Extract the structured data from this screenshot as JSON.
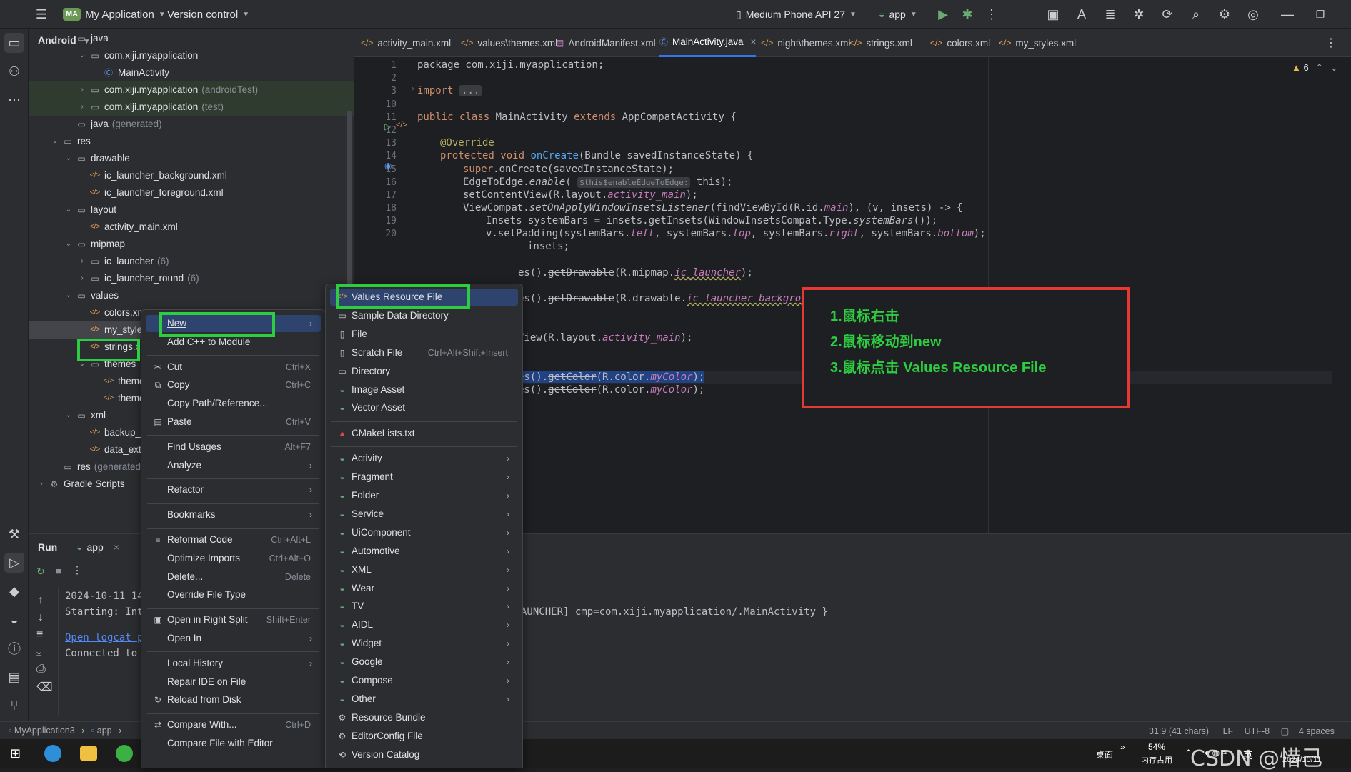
{
  "titlebar": {
    "project_badge": "MA",
    "project_name": "My Application",
    "version_control": "Version control",
    "device": "Medium Phone API 27",
    "run_config": "app"
  },
  "project_panel": {
    "view_selector": "Android",
    "tree": [
      {
        "label": "java",
        "extra": "",
        "indent": 2,
        "arrow": "down",
        "icon": "folder"
      },
      {
        "label": "com.xiji.myapplication",
        "extra": "",
        "indent": 3,
        "arrow": "down",
        "icon": "folder"
      },
      {
        "label": "MainActivity",
        "extra": "",
        "indent": 4,
        "arrow": "",
        "icon": "class"
      },
      {
        "label": "com.xiji.myapplication",
        "extra": "(androidTest)",
        "indent": 3,
        "arrow": "right",
        "icon": "folder"
      },
      {
        "label": "com.xiji.myapplication",
        "extra": "(test)",
        "indent": 3,
        "arrow": "right",
        "icon": "folder"
      },
      {
        "label": "java",
        "extra": "(generated)",
        "indent": 2,
        "arrow": "",
        "icon": "folder"
      },
      {
        "label": "res",
        "extra": "",
        "indent": 1,
        "arrow": "down",
        "icon": "folder"
      },
      {
        "label": "drawable",
        "extra": "",
        "indent": 2,
        "arrow": "down",
        "icon": "folder"
      },
      {
        "label": "ic_launcher_background.xml",
        "extra": "",
        "indent": 3,
        "arrow": "",
        "icon": "xml"
      },
      {
        "label": "ic_launcher_foreground.xml",
        "extra": "",
        "indent": 3,
        "arrow": "",
        "icon": "xml"
      },
      {
        "label": "layout",
        "extra": "",
        "indent": 2,
        "arrow": "down",
        "icon": "folder"
      },
      {
        "label": "activity_main.xml",
        "extra": "",
        "indent": 3,
        "arrow": "",
        "icon": "xml"
      },
      {
        "label": "mipmap",
        "extra": "",
        "indent": 2,
        "arrow": "down",
        "icon": "folder"
      },
      {
        "label": "ic_launcher",
        "extra": "(6)",
        "indent": 3,
        "arrow": "right",
        "icon": "folder"
      },
      {
        "label": "ic_launcher_round",
        "extra": "(6)",
        "indent": 3,
        "arrow": "right",
        "icon": "folder"
      },
      {
        "label": "values",
        "extra": "",
        "indent": 2,
        "arrow": "down",
        "icon": "folder"
      },
      {
        "label": "colors.xml",
        "extra": "",
        "indent": 3,
        "arrow": "",
        "icon": "xml"
      },
      {
        "label": "my_styles.xml",
        "extra": "",
        "indent": 3,
        "arrow": "",
        "icon": "xml"
      },
      {
        "label": "strings.xml",
        "extra": "",
        "indent": 3,
        "arrow": "",
        "icon": "xml"
      },
      {
        "label": "themes",
        "extra": "",
        "indent": 3,
        "arrow": "down",
        "icon": "folder"
      },
      {
        "label": "themes.xml",
        "extra": "",
        "indent": 4,
        "arrow": "",
        "icon": "xml"
      },
      {
        "label": "themes.xml",
        "extra": "(night)",
        "indent": 4,
        "arrow": "",
        "icon": "xml"
      },
      {
        "label": "xml",
        "extra": "",
        "indent": 2,
        "arrow": "down",
        "icon": "folder"
      },
      {
        "label": "backup_rules.xml",
        "extra": "",
        "indent": 3,
        "arrow": "",
        "icon": "xml"
      },
      {
        "label": "data_extraction_rules.xml",
        "extra": "",
        "indent": 3,
        "arrow": "",
        "icon": "xml"
      },
      {
        "label": "res",
        "extra": "(generated)",
        "indent": 1,
        "arrow": "",
        "icon": "folder"
      },
      {
        "label": "Gradle Scripts",
        "extra": "",
        "indent": 0,
        "arrow": "right",
        "icon": "gradle"
      }
    ]
  },
  "tabs": [
    {
      "label": "activity_main.xml",
      "icon": "xml"
    },
    {
      "label": "values\\themes.xml",
      "icon": "xml"
    },
    {
      "label": "AndroidManifest.xml",
      "icon": "manifest"
    },
    {
      "label": "MainActivity.java",
      "icon": "class",
      "active": true
    },
    {
      "label": "night\\themes.xml",
      "icon": "xml"
    },
    {
      "label": "strings.xml",
      "icon": "xml"
    },
    {
      "label": "colors.xml",
      "icon": "xml"
    },
    {
      "label": "my_styles.xml",
      "icon": "xml"
    }
  ],
  "editor": {
    "warnings": "6",
    "line_numbers": [
      "1",
      "2",
      "3",
      "10",
      "11",
      "12",
      "13",
      "14",
      "15",
      "16",
      "17",
      "18",
      "19",
      "20"
    ],
    "inlay_hint": "$this$enableEdgeToEdge:",
    "fragments": {
      "l1": "package com.xiji.myapplication;",
      "l3_kw": "import",
      "l3_fold": "...",
      "l11_a": "public class",
      "l11_b": " MainActivity ",
      "l11_c": "extends",
      "l11_d": " AppCompatActivity {",
      "l13": "@Override",
      "l14_a": "protected void ",
      "l14_b": "onCreate",
      "l14_c": "(Bundle savedInstanceState) {",
      "l15_a": "super",
      "l15_b": ".onCreate(savedInstanceState);",
      "l16_a": "EdgeToEdge.",
      "l16_b": "enable",
      "l16_c": "( ",
      "l16_d": " this);",
      "l17_a": "setContentView(R.layout.",
      "l17_b": "activity_main",
      "l17_c": ");",
      "l18_a": "ViewCompat.",
      "l18_b": "setOnApplyWindowInsetsListener",
      "l18_c": "(findViewById(R.id.",
      "l18_d": "main",
      "l18_e": "), (v, insets) -> {",
      "l19_a": "Insets systemBars = insets.getInsets(WindowInsetsCompat.Type.",
      "l19_b": "systemBars",
      "l19_c": "());",
      "l20_a": "v.setPadding(systemBars.",
      "l20_b": "left",
      "l20_c": ", systemBars.",
      "l20_d": "top",
      "l20_e": ", systemBars.",
      "l20_f": "right",
      "l20_g": ", systemBars.",
      "l20_h": "bottom",
      "l20_i": ");",
      "l21": "insets;",
      "l22_a": "es().",
      "l22_b": "getDrawable",
      "l22_c": "(R.mipmap.",
      "l22_d": "ic_launcher",
      "l22_e": ");",
      "l23_a": "es().",
      "l23_b": "getDrawable",
      "l23_c": "(R.drawable.",
      "l23_d": "ic_launcher_background",
      "l23_e": ");",
      "l24_a": "View(R.layout.",
      "l24_b": "activity_main",
      "l24_c": ");",
      "l25_a": "es().",
      "l25_b": "getColor",
      "l25_c": "(R.color.",
      "l25_d": "myColor",
      "l25_e": ");",
      "l26_a": "es().",
      "l26_b": "getColor",
      "l26_c": "(R.color.",
      "l26_d": "myColor",
      "l26_e": ");"
    }
  },
  "annotation": {
    "lines": [
      "1.鼠标右击",
      "2.鼠标移动到new",
      "3.鼠标点击 Values Resource File"
    ]
  },
  "run_panel": {
    "title": "Run",
    "tab": "app",
    "console": [
      "2024-10-11 14",
      "Starting: Int",
      "",
      "Open logcat pa",
      "Connected to p"
    ],
    "console_tail": "AUNCHER] cmp=com.xiji.myapplication/.MainActivity }"
  },
  "context_menu": [
    {
      "label": "New",
      "submenu": true,
      "selected": true
    },
    {
      "label": "Add C++ to Module"
    },
    {
      "sep": true
    },
    {
      "label": "Cut",
      "icon": "cut-icon",
      "glyph": "✂",
      "shortcut": "Ctrl+X"
    },
    {
      "label": "Copy",
      "icon": "copy-icon",
      "glyph": "⧉",
      "shortcut": "Ctrl+C"
    },
    {
      "label": "Copy Path/Reference..."
    },
    {
      "label": "Paste",
      "icon": "paste-icon",
      "glyph": "▤",
      "shortcut": "Ctrl+V"
    },
    {
      "sep": true
    },
    {
      "label": "Find Usages",
      "shortcut": "Alt+F7"
    },
    {
      "label": "Analyze",
      "submenu": true
    },
    {
      "sep": true
    },
    {
      "label": "Refactor",
      "submenu": true
    },
    {
      "sep": true
    },
    {
      "label": "Bookmarks",
      "submenu": true
    },
    {
      "sep": true
    },
    {
      "label": "Reformat Code",
      "icon": "reformat-icon",
      "glyph": "≡",
      "shortcut": "Ctrl+Alt+L"
    },
    {
      "label": "Optimize Imports",
      "shortcut": "Ctrl+Alt+O"
    },
    {
      "label": "Delete...",
      "shortcut": "Delete"
    },
    {
      "label": "Override File Type"
    },
    {
      "sep": true
    },
    {
      "label": "Open in Right Split",
      "icon": "split-icon",
      "glyph": "▣",
      "shortcut": "Shift+Enter"
    },
    {
      "label": "Open In",
      "submenu": true
    },
    {
      "sep": true
    },
    {
      "label": "Local History",
      "submenu": true
    },
    {
      "label": "Repair IDE on File"
    },
    {
      "label": "Reload from Disk",
      "icon": "reload-icon",
      "glyph": "↻"
    },
    {
      "sep": true
    },
    {
      "label": "Compare With...",
      "icon": "compare-icon",
      "glyph": "⇄",
      "shortcut": "Ctrl+D"
    },
    {
      "label": "Compare File with Editor"
    }
  ],
  "new_submenu": [
    {
      "label": "Values Resource File",
      "icon": "xml-file-icon",
      "glyph": "</>",
      "selected": true
    },
    {
      "label": "Sample Data Directory",
      "icon": "folder-icon",
      "glyph": "▭"
    },
    {
      "label": "File",
      "icon": "file-icon",
      "glyph": "▯"
    },
    {
      "label": "Scratch File",
      "icon": "scratch-icon",
      "glyph": "▯",
      "shortcut": "Ctrl+Alt+Shift+Insert"
    },
    {
      "label": "Directory",
      "icon": "folder-icon",
      "glyph": "▭"
    },
    {
      "label": "Image Asset",
      "icon": "android-icon",
      "glyph": "◒"
    },
    {
      "label": "Vector Asset",
      "icon": "android-icon",
      "glyph": "◒"
    },
    {
      "sep": true
    },
    {
      "label": "CMakeLists.txt",
      "icon": "cmake-icon",
      "glyph": "▲"
    },
    {
      "sep": true
    },
    {
      "label": "Activity",
      "icon": "android-icon",
      "glyph": "◒",
      "submenu": true
    },
    {
      "label": "Fragment",
      "icon": "android-icon",
      "glyph": "◒",
      "submenu": true
    },
    {
      "label": "Folder",
      "icon": "android-icon",
      "glyph": "◒",
      "submenu": true
    },
    {
      "label": "Service",
      "icon": "android-icon",
      "glyph": "◒",
      "submenu": true
    },
    {
      "label": "UiComponent",
      "icon": "android-icon",
      "glyph": "◒",
      "submenu": true
    },
    {
      "label": "Automotive",
      "icon": "android-icon",
      "glyph": "◒",
      "submenu": true
    },
    {
      "label": "XML",
      "icon": "android-icon",
      "glyph": "◒",
      "submenu": true
    },
    {
      "label": "Wear",
      "icon": "android-icon",
      "glyph": "◒",
      "submenu": true
    },
    {
      "label": "TV",
      "icon": "android-icon",
      "glyph": "◒",
      "submenu": true
    },
    {
      "label": "AIDL",
      "icon": "android-icon",
      "glyph": "◒",
      "submenu": true
    },
    {
      "label": "Widget",
      "icon": "android-icon",
      "glyph": "◒",
      "submenu": true
    },
    {
      "label": "Google",
      "icon": "android-icon",
      "glyph": "◒",
      "submenu": true
    },
    {
      "label": "Compose",
      "icon": "android-icon",
      "glyph": "◒",
      "submenu": true
    },
    {
      "label": "Other",
      "icon": "android-icon",
      "glyph": "◒",
      "submenu": true
    },
    {
      "label": "Resource Bundle",
      "icon": "gear-icon",
      "glyph": "⚙"
    },
    {
      "label": "EditorConfig File",
      "icon": "gear-icon",
      "glyph": "⚙"
    },
    {
      "label": "Version Catalog",
      "icon": "catalog-icon",
      "glyph": "⟲"
    }
  ],
  "statusbar": {
    "breadcrumb": [
      "MyApplication3",
      "app"
    ],
    "position": "31:9 (41 chars)",
    "line_ending": "LF",
    "encoding": "UTF-8",
    "indent": "4 spaces"
  },
  "taskbar": {
    "desktop": "桌面",
    "memory_percent": "54%",
    "memory_label": "内存占用",
    "ime": "英",
    "date": "2024/10/11",
    "watermark": "CSDN @惜己"
  },
  "colors": {
    "accent": "#3574f0",
    "highlight_green": "#2ecc40",
    "annotation_red": "#e53935",
    "selection": "#2e436e"
  }
}
